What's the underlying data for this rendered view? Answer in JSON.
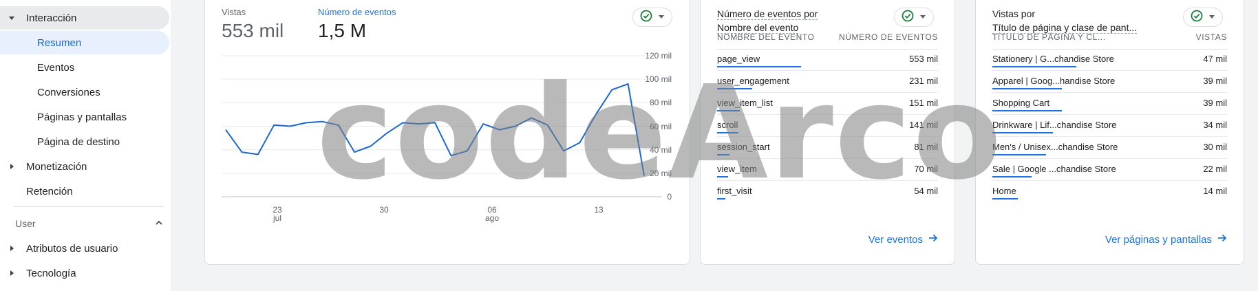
{
  "sidebar": {
    "items": [
      {
        "label": "Interacción"
      },
      {
        "label": "Resumen"
      },
      {
        "label": "Eventos"
      },
      {
        "label": "Conversiones"
      },
      {
        "label": "Páginas y pantallas"
      },
      {
        "label": "Página de destino"
      },
      {
        "label": "Monetización"
      },
      {
        "label": "Retención"
      }
    ],
    "user_section": {
      "label": "User",
      "items": [
        {
          "label": "Atributos de usuario"
        },
        {
          "label": "Tecnología"
        }
      ]
    }
  },
  "chart_card": {
    "metric1": {
      "label": "Vistas",
      "value": "553 mil"
    },
    "metric2": {
      "label": "Número de eventos",
      "value": "1,5 M"
    },
    "colors": {
      "accent": "#1a73e8",
      "line": "#1967d2",
      "status_ok": "#188038"
    }
  },
  "chart_data": {
    "type": "line",
    "title": "",
    "xlabel": "",
    "ylabel": "",
    "x_ticks": [
      {
        "day": "23",
        "month": "jul"
      },
      {
        "day": "30",
        "month": ""
      },
      {
        "day": "06",
        "month": "ago"
      },
      {
        "day": "13",
        "month": ""
      }
    ],
    "y_ticks": [
      "120 mil",
      "100 mil",
      "80 mil",
      "60 mil",
      "40 mil",
      "20 mil",
      "0"
    ],
    "ylim": [
      0,
      120000
    ],
    "series": [
      {
        "values": [
          57000,
          38000,
          36000,
          61000,
          60000,
          63000,
          64000,
          61000,
          38000,
          43000,
          54000,
          63000,
          62000,
          63000,
          35000,
          39000,
          62000,
          57000,
          60000,
          67000,
          61000,
          39000,
          46000,
          70000,
          91000,
          96000,
          18000
        ]
      }
    ]
  },
  "events_card": {
    "title_line1": "Número de eventos por",
    "title_line2": "Nombre del evento",
    "col_name": "NOMBRE DEL EVENTO",
    "col_value": "NÚMERO DE EVENTOS",
    "rows": [
      {
        "name": "page_view",
        "value": "553 mil",
        "bar": 1.0
      },
      {
        "name": "user_engagement",
        "value": "231 mil",
        "bar": 0.42
      },
      {
        "name": "view_item_list",
        "value": "151 mil",
        "bar": 0.27
      },
      {
        "name": "scroll",
        "value": "141 mil",
        "bar": 0.25
      },
      {
        "name": "session_start",
        "value": "81 mil",
        "bar": 0.15
      },
      {
        "name": "view_item",
        "value": "70 mil",
        "bar": 0.13
      },
      {
        "name": "first_visit",
        "value": "54 mil",
        "bar": 0.1
      }
    ],
    "link": "Ver eventos"
  },
  "pages_card": {
    "title_line1": "Vistas por",
    "title_line2": "Título de página y clase de pant...",
    "col_name": "TÍTULO DE PÁGINA Y CL...",
    "col_value": "VISTAS",
    "rows": [
      {
        "name": "Stationery | G...chandise Store",
        "value": "47 mil",
        "bar": 1.0
      },
      {
        "name": "Apparel | Goog...handise Store",
        "value": "39 mil",
        "bar": 0.83
      },
      {
        "name": "Shopping Cart",
        "value": "39 mil",
        "bar": 0.83
      },
      {
        "name": "Drinkware | Lif...chandise Store",
        "value": "34 mil",
        "bar": 0.72
      },
      {
        "name": "Men's / Unisex...chandise Store",
        "value": "30 mil",
        "bar": 0.64
      },
      {
        "name": "Sale | Google ...chandise Store",
        "value": "22 mil",
        "bar": 0.47
      },
      {
        "name": "Home",
        "value": "14 mil",
        "bar": 0.3
      }
    ],
    "link": "Ver páginas y pantallas"
  },
  "watermark": "codeArco"
}
